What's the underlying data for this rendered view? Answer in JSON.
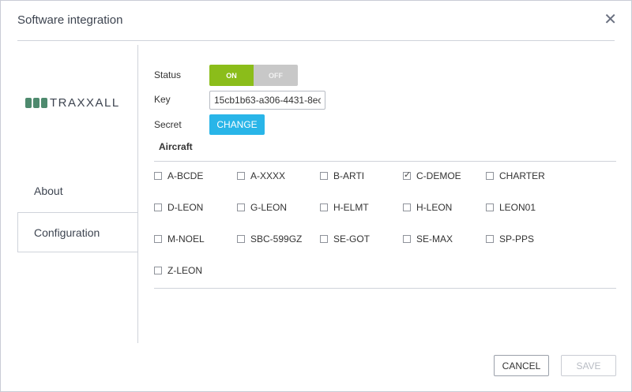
{
  "dialog": {
    "title": "Software integration",
    "close_icon": "close-icon"
  },
  "sidebar": {
    "logo_text": "TRAXXALL",
    "items": [
      {
        "label": "About",
        "selected": false
      },
      {
        "label": "Configuration",
        "selected": true
      }
    ]
  },
  "config": {
    "status_label": "Status",
    "toggle_on": "ON",
    "toggle_off": "OFF",
    "status_value": "ON",
    "key_label": "Key",
    "key_value": "15cb1b63-a306-4431-8ec",
    "secret_label": "Secret",
    "change_label": "CHANGE",
    "aircraft_title": "Aircraft"
  },
  "aircraft": [
    {
      "code": "A-BCDE",
      "checked": false
    },
    {
      "code": "A-XXXX",
      "checked": false
    },
    {
      "code": "B-ARTI",
      "checked": false
    },
    {
      "code": "C-DEMOE",
      "checked": true
    },
    {
      "code": "CHARTER",
      "checked": false
    },
    {
      "code": "D-LEON",
      "checked": false
    },
    {
      "code": "G-LEON",
      "checked": false
    },
    {
      "code": "H-ELMT",
      "checked": false
    },
    {
      "code": "H-LEON",
      "checked": false
    },
    {
      "code": "LEON01",
      "checked": false
    },
    {
      "code": "M-NOEL",
      "checked": false
    },
    {
      "code": "SBC-599GZ",
      "checked": false
    },
    {
      "code": "SE-GOT",
      "checked": false
    },
    {
      "code": "SE-MAX",
      "checked": false
    },
    {
      "code": "SP-PPS",
      "checked": false
    },
    {
      "code": "Z-LEON",
      "checked": false
    }
  ],
  "footer": {
    "cancel_label": "CANCEL",
    "save_label": "SAVE"
  },
  "colors": {
    "toggle_on": "#8bbd1a",
    "toggle_off": "#c8c8c8",
    "change_button": "#29b5e8",
    "logo": "#4e8a6e"
  }
}
